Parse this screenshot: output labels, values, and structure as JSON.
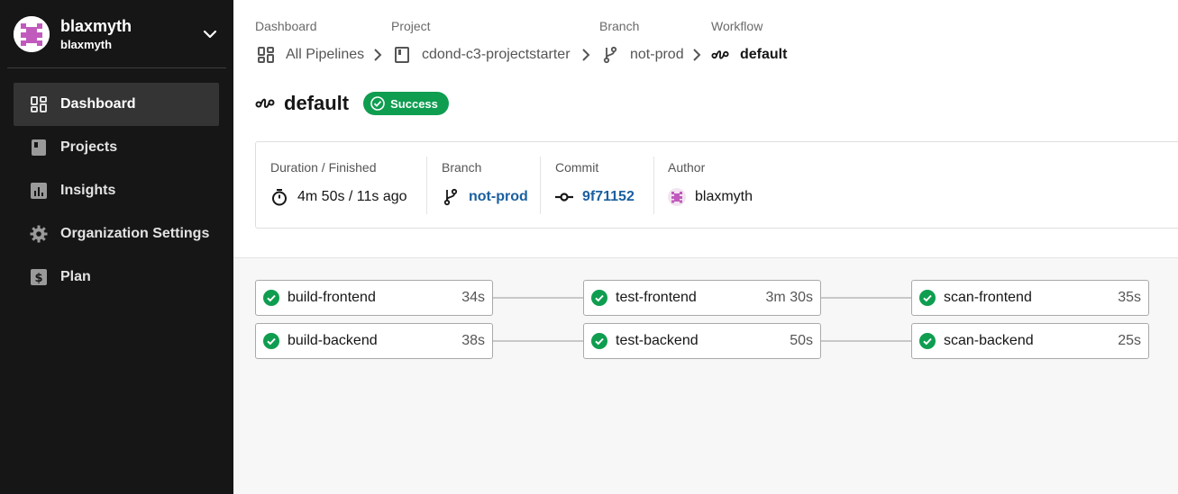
{
  "org": {
    "name": "blaxmyth",
    "subname": "blaxmyth"
  },
  "nav": {
    "items": [
      {
        "label": "Dashboard",
        "icon": "dashboard-icon"
      },
      {
        "label": "Projects",
        "icon": "projects-icon"
      },
      {
        "label": "Insights",
        "icon": "insights-icon"
      },
      {
        "label": "Organization Settings",
        "icon": "gear-icon"
      },
      {
        "label": "Plan",
        "icon": "dollar-icon"
      }
    ],
    "active": "Dashboard"
  },
  "breadcrumb": {
    "dashboard": {
      "label": "Dashboard",
      "value": "All Pipelines"
    },
    "project": {
      "label": "Project",
      "value": "cdond-c3-projectstarter"
    },
    "branch": {
      "label": "Branch",
      "value": "not-prod"
    },
    "workflow": {
      "label": "Workflow",
      "value": "default"
    }
  },
  "workflow": {
    "title": "default",
    "status": "Success"
  },
  "info": {
    "duration_label": "Duration / Finished",
    "duration_value": "4m 50s / 11s ago",
    "branch_label": "Branch",
    "branch_value": "not-prod",
    "commit_label": "Commit",
    "commit_value": "9f71152",
    "author_label": "Author",
    "author_value": "blaxmyth"
  },
  "jobs": [
    {
      "name": "build-frontend",
      "duration": "34s",
      "status": "success"
    },
    {
      "name": "test-frontend",
      "duration": "3m 30s",
      "status": "success"
    },
    {
      "name": "scan-frontend",
      "duration": "35s",
      "status": "success"
    },
    {
      "name": "build-backend",
      "duration": "38s",
      "status": "success"
    },
    {
      "name": "test-backend",
      "duration": "50s",
      "status": "success"
    },
    {
      "name": "scan-backend",
      "duration": "25s",
      "status": "success"
    }
  ],
  "colors": {
    "sidebar_bg": "#161616",
    "sidebar_active": "#343434",
    "success": "#0f9d50",
    "link": "#1a5fa0",
    "avatar_accent": "#c05bbd"
  }
}
